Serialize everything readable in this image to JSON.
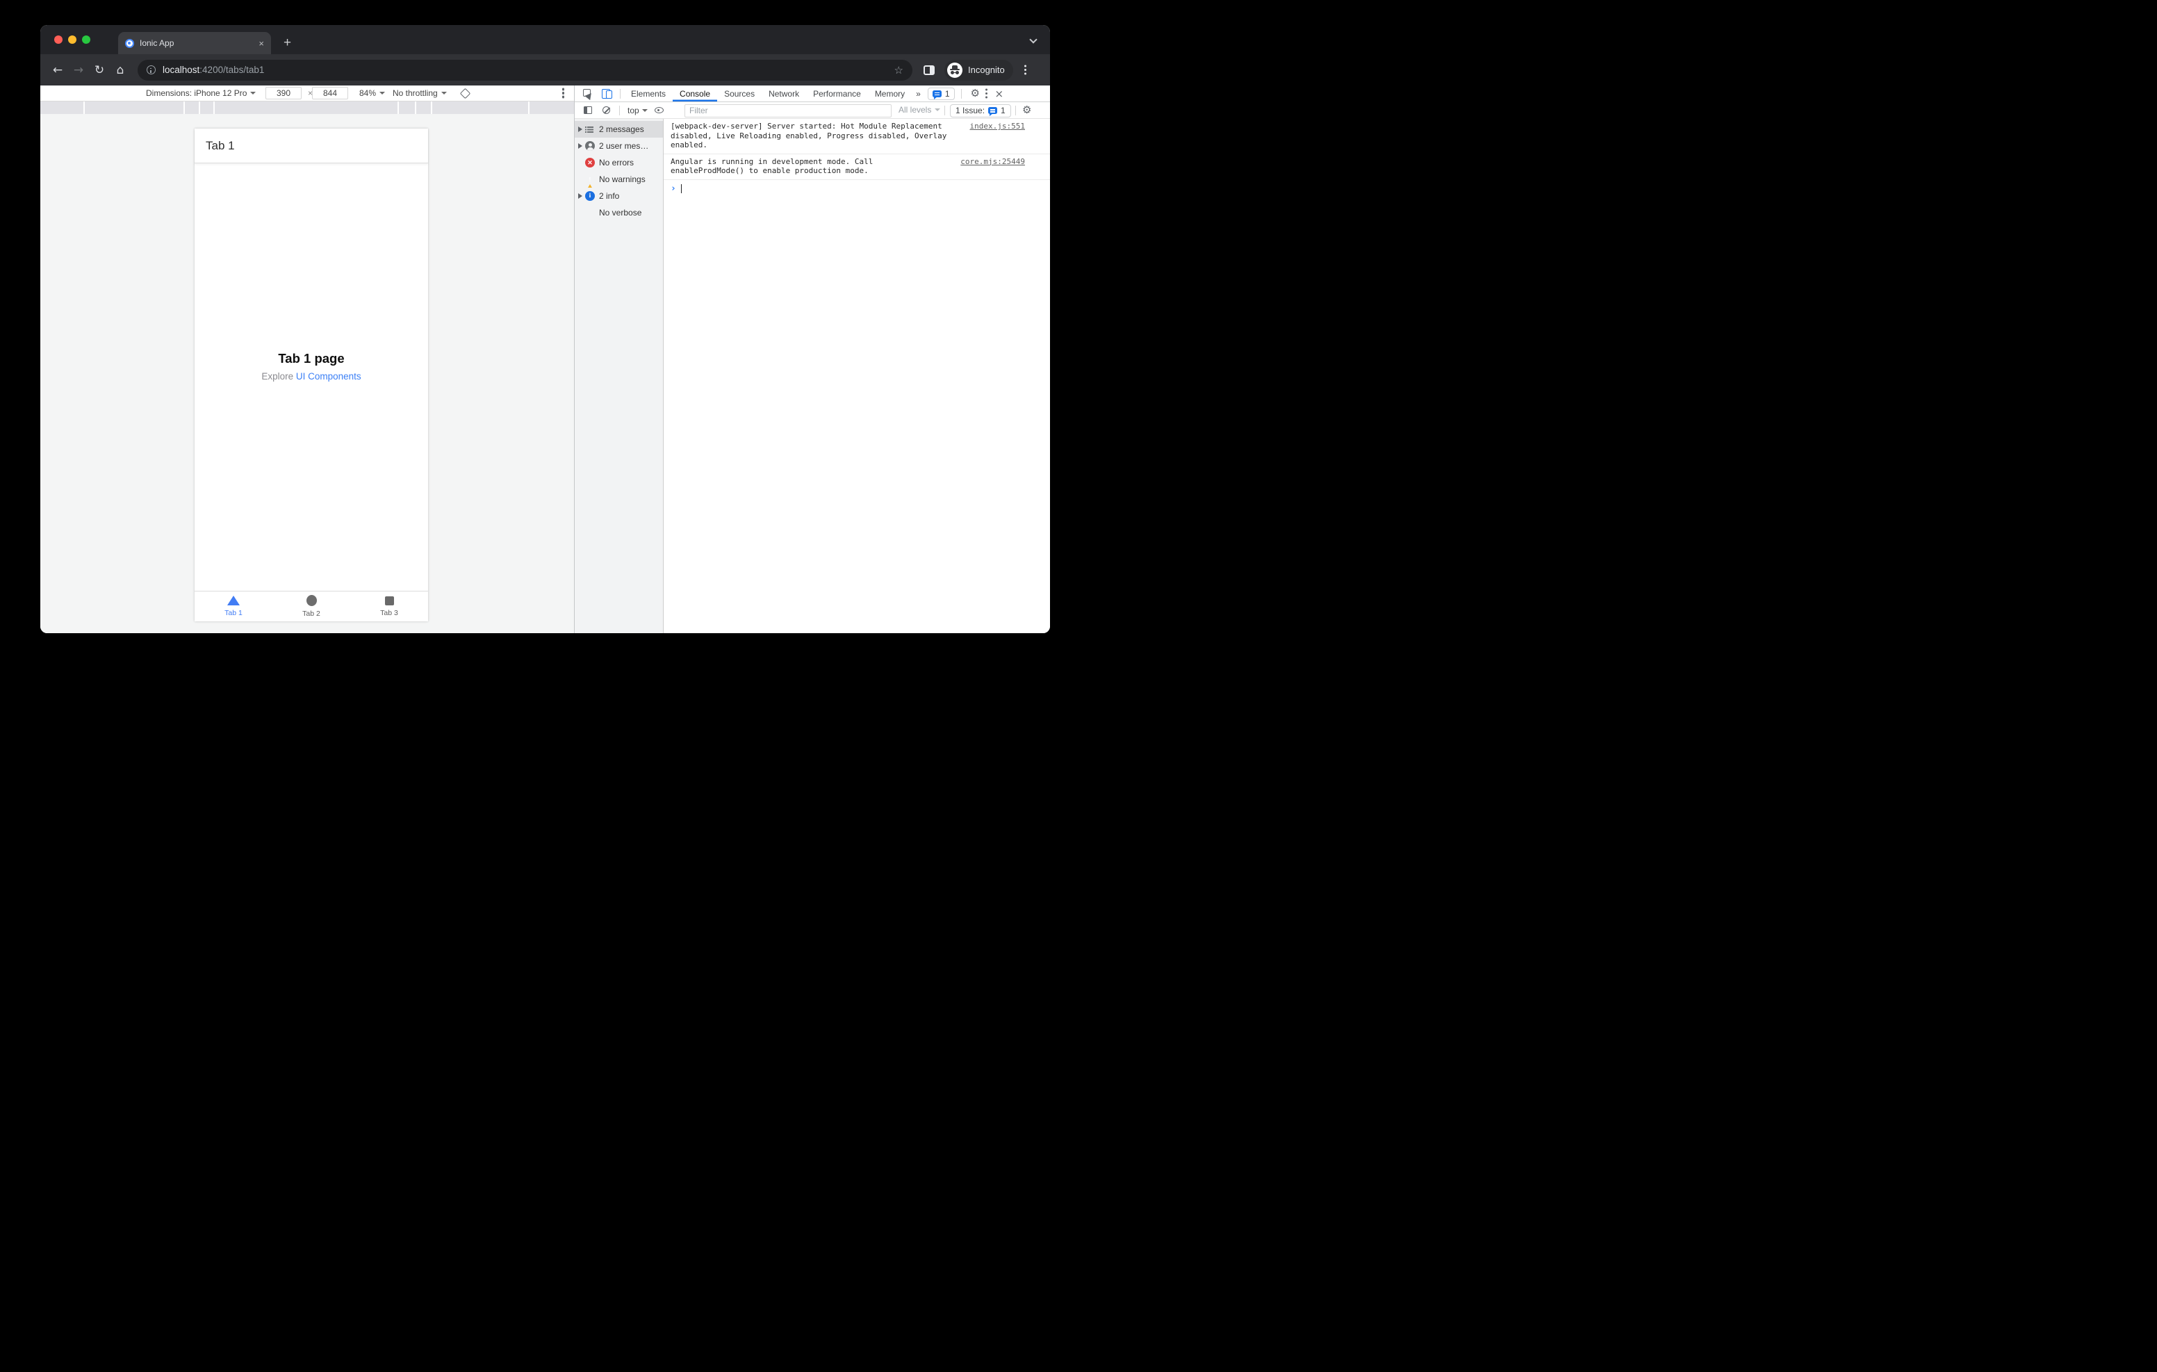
{
  "browser": {
    "tab_title": "Ionic App",
    "url": {
      "host": "localhost",
      "rest": ":4200/tabs/tab1"
    },
    "incognito_label": "Incognito"
  },
  "icons": {
    "back": "←",
    "forward": "→",
    "reload": "↻",
    "home": "⌂",
    "star": "☆",
    "new_tab": "+",
    "close_tab": "×",
    "close_devtools": "×",
    "more_tabs": "»",
    "gear": "⚙",
    "prompt": "›",
    "times": "×"
  },
  "device_toolbar": {
    "dimensions_label": "Dimensions: iPhone 12 Pro",
    "width": "390",
    "height": "844",
    "zoom": "84%",
    "throttling": "No throttling"
  },
  "devtools": {
    "tabs": [
      "Elements",
      "Console",
      "Sources",
      "Network",
      "Performance",
      "Memory"
    ],
    "active_tab": "Console",
    "tabbar_issue_count": "1",
    "toolbar": {
      "context": "top",
      "filter_placeholder": "Filter",
      "levels": "All levels",
      "issue_label": "1 Issue:",
      "issue_count": "1"
    },
    "sidebar": [
      "2 messages",
      "2 user mes…",
      "No errors",
      "No warnings",
      "2 info",
      "No verbose"
    ],
    "sidebar_selected": "2 messages",
    "messages": [
      {
        "text": "[webpack-dev-server] Server started: Hot Module Replacement disabled, Live Reloading enabled, Progress disabled, Overlay enabled.",
        "source": "index.js:551"
      },
      {
        "text": "Angular is running in development mode. Call enableProdMode() to enable production mode.",
        "source": "core.mjs:25449"
      }
    ]
  },
  "app": {
    "header_title": "Tab 1",
    "page_title": "Tab 1 page",
    "explore_text": "Explore ",
    "explore_link": "UI Components",
    "tabs": [
      "Tab 1",
      "Tab 2",
      "Tab 3"
    ],
    "active_tab": "Tab 1"
  },
  "colors": {
    "accent_blue": "#1a73e8",
    "ionic_blue": "#417cf4",
    "link_blue": "#3c80f6",
    "error_red": "#df4040",
    "warning_yellow": "#f2b32c",
    "info_blue": "#1b6fe0",
    "chrome_dark": "#232428",
    "toolbar_dark": "#313236",
    "traffic_red": "#ff5f57",
    "traffic_yellow": "#febc2e",
    "traffic_green": "#28c840"
  }
}
